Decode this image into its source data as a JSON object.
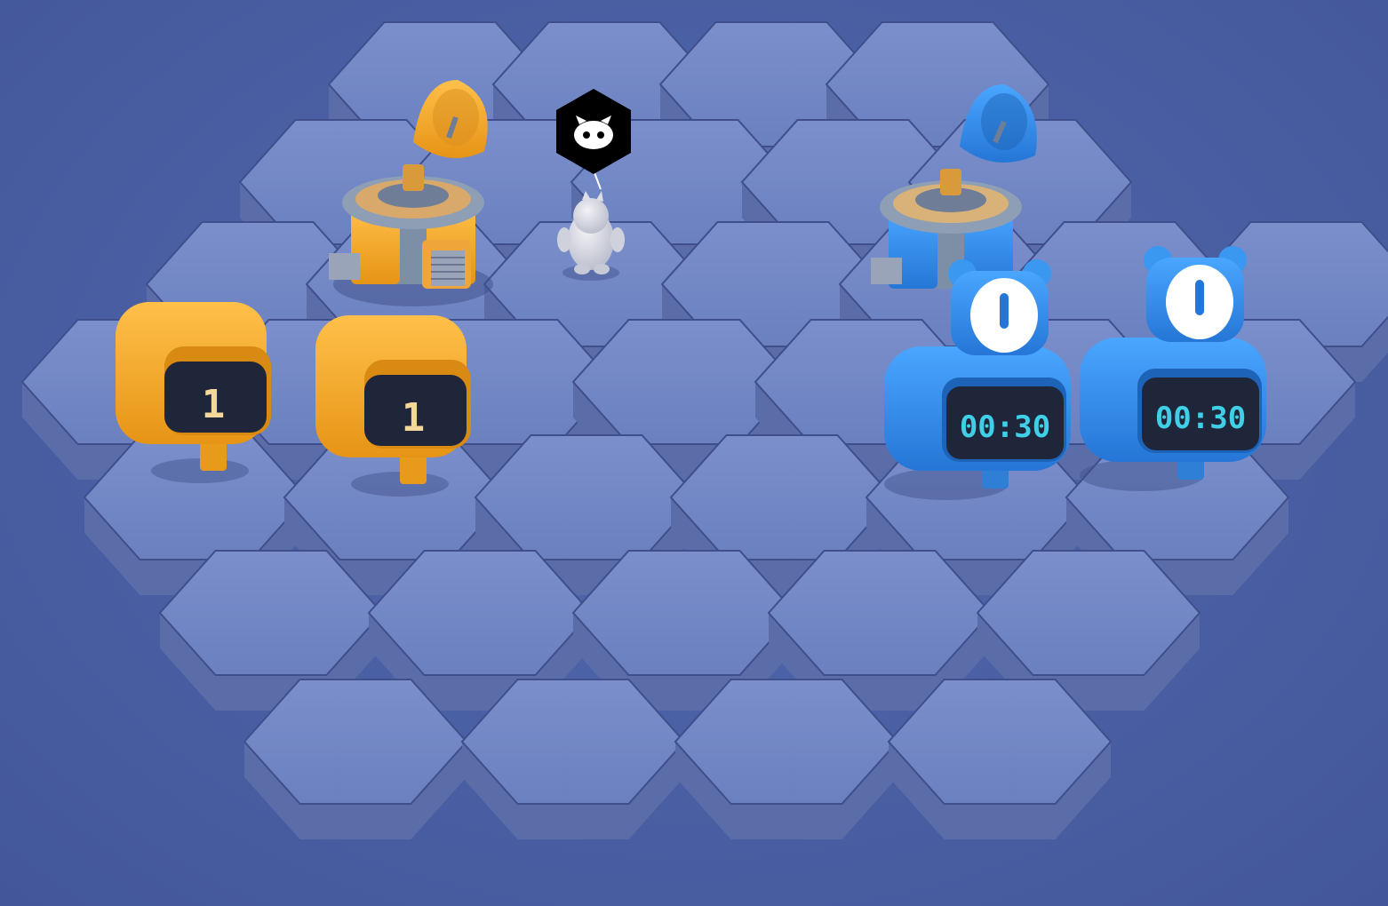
{
  "scene": {
    "name": "hex-board-game",
    "colors": {
      "background": "#4a5fa3",
      "tile_top": "#7186c4",
      "tile_side": "#5a6da8",
      "tile_edge": "#3f4f8c",
      "orange_team": "#f5a623",
      "blue_team": "#2f8ae0",
      "screen_dark": "#20263a",
      "timer_text": "#3fd0e8",
      "counter_text": "#f3d89a"
    }
  },
  "player": {
    "marker_icon": "robot-face-icon",
    "character": "gray-blob-character"
  },
  "orange_base": {
    "building": "orange-radar-station",
    "counters": [
      {
        "label": "1"
      },
      {
        "label": "1"
      }
    ]
  },
  "blue_base": {
    "building": "blue-radar-station",
    "timers": [
      {
        "label": "00:30"
      },
      {
        "label": "00:30"
      }
    ]
  }
}
